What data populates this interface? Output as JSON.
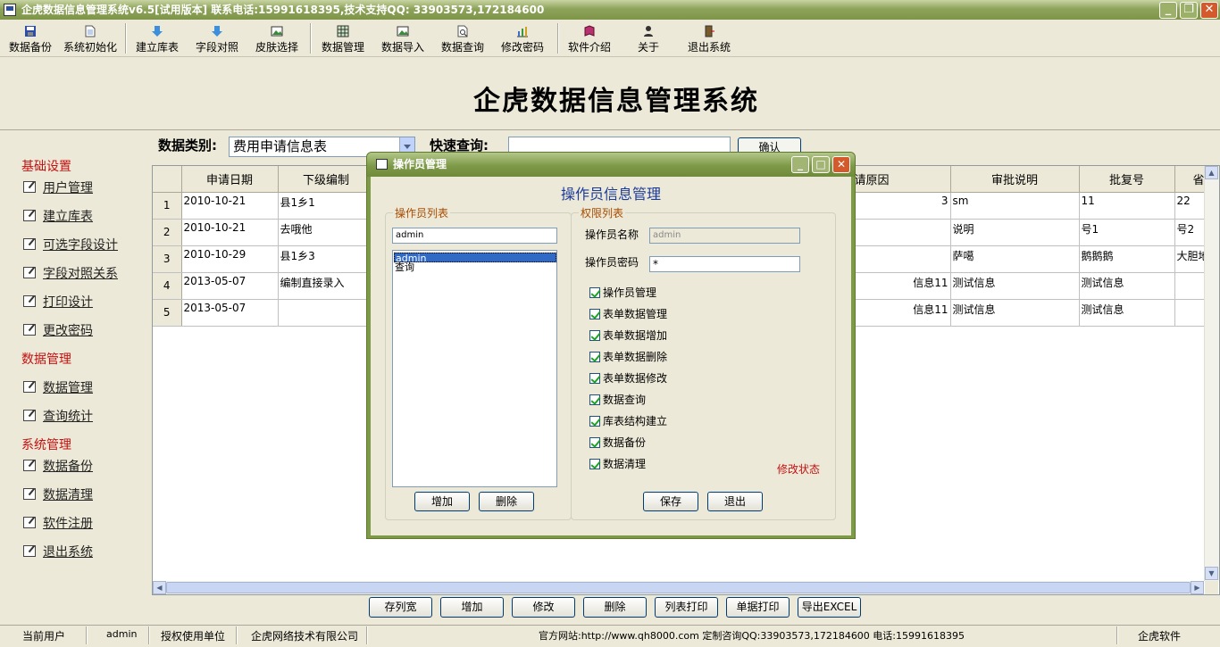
{
  "window": {
    "title": "企虎数据信息管理系统v6.5[试用版本]   联系电话:15991618395,技术支持QQ: 33903573,172184600"
  },
  "toolbar": [
    {
      "label": "数据备份",
      "icon": "save-icon"
    },
    {
      "label": "系统初始化",
      "icon": "document-icon"
    },
    {
      "label": "建立库表",
      "icon": "down-arrow-icon"
    },
    {
      "label": "字段对照",
      "icon": "down-arrow-icon"
    },
    {
      "label": "皮肤选择",
      "icon": "image-icon"
    },
    {
      "label": "数据管理",
      "icon": "grid-icon"
    },
    {
      "label": "数据导入",
      "icon": "image-icon"
    },
    {
      "label": "数据查询",
      "icon": "search-document-icon"
    },
    {
      "label": "修改密码",
      "icon": "chart-icon"
    },
    {
      "label": "软件介绍",
      "icon": "book-icon"
    },
    {
      "label": "关于",
      "icon": "person-icon"
    },
    {
      "label": "退出系统",
      "icon": "exit-door-icon"
    }
  ],
  "banner": {
    "title": "企虎数据信息管理系统"
  },
  "sidebar": {
    "sections": [
      "基础设置",
      "数据管理",
      "系统管理"
    ],
    "items": [
      "用户管理",
      "建立库表",
      "可选字段设计",
      "字段对照关系",
      "打印设计",
      "更改密码",
      "数据管理",
      "查询统计",
      "数据备份",
      "数据清理",
      "软件注册",
      "退出系统"
    ]
  },
  "filter": {
    "category_label": "数据类别:",
    "category_value": "费用申请信息表",
    "search_label": "快速查询:",
    "search_value": "",
    "confirm_label": "确认"
  },
  "grid": {
    "headers_left": [
      "申请日期",
      "下级编制"
    ],
    "headers_right": [
      "请原因",
      "审批说明",
      "批复号",
      "省批复号"
    ],
    "rows": [
      {
        "n": "1",
        "date": "2010-10-21",
        "sub": "县1乡1",
        "reason": "3",
        "note": "sm",
        "reply": "11",
        "prov": "22"
      },
      {
        "n": "2",
        "date": "2010-10-21",
        "sub": "去哦他",
        "reason": "",
        "note": "说明",
        "reply": "号1",
        "prov": "号2"
      },
      {
        "n": "3",
        "date": "2010-10-29",
        "sub": "县1乡3",
        "reason": "",
        "note": "萨噶",
        "reply": "鹅鹅鹅",
        "prov": "大胆地"
      },
      {
        "n": "4",
        "date": "2013-05-07",
        "sub": "编制直接录入",
        "reason": "信息11",
        "note": "测试信息",
        "reply": "测试信息",
        "prov": ""
      },
      {
        "n": "5",
        "date": "2013-05-07",
        "sub": "",
        "reason": "信息11",
        "note": "测试信息",
        "reply": "测试信息",
        "prov": ""
      }
    ]
  },
  "bottom_buttons": [
    "存列宽",
    "增加",
    "修改",
    "删除",
    "列表打印",
    "单据打印",
    "导出EXCEL"
  ],
  "status": {
    "user_label": "当前用户",
    "user": "admin",
    "unit_label": "授权使用单位",
    "unit": "企虎网络技术有限公司",
    "contact": "官方网站:http://www.qh8000.com 定制咨询QQ:33903573,172184600 电话:15991618395",
    "brand": "企虎软件"
  },
  "dialog": {
    "title": "操作员管理",
    "heading": "操作员信息管理",
    "list_group": "操作员列表",
    "list_filter_value": "admin",
    "operators": [
      "admin",
      "查询"
    ],
    "selected": "admin",
    "add_label": "增加",
    "delete_label": "删除",
    "perm_group": "权限列表",
    "name_label": "操作员名称",
    "name_value": "admin",
    "pwd_label": "操作员密码",
    "pwd_value": "*",
    "permissions": [
      "操作员管理",
      "表单数据管理",
      "表单数据增加",
      "表单数据删除",
      "表单数据修改",
      "数据查询",
      "库表结构建立",
      "数据备份",
      "数据清理"
    ],
    "status_text": "修改状态",
    "save_label": "保存",
    "exit_label": "退出",
    "status_color": "#c41010"
  }
}
